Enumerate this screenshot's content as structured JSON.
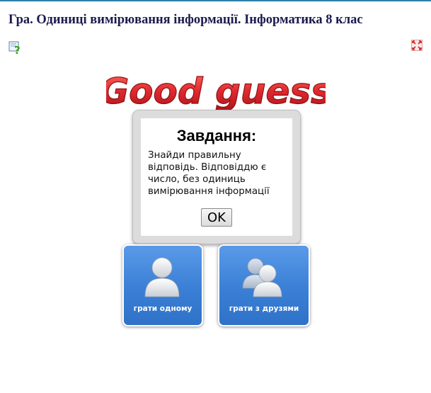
{
  "page": {
    "title": "Гра. Одиниці вимірювання інформації. Інформатика 8 клас",
    "help_icon": "help-question-icon",
    "fullscreen_icon": "fullscreen-toggle-icon"
  },
  "game": {
    "logo_text": "Good guess",
    "dialog": {
      "title": "Завдання:",
      "text": "Знайди правильну відповідь. Відповіддю є число, без одиниць вимірювання інформації",
      "ok_label": "OK"
    },
    "modes": [
      {
        "label": "грати одному",
        "icon": "single-user-icon"
      },
      {
        "label": "грати з друзями",
        "icon": "multi-user-icon"
      }
    ]
  },
  "colors": {
    "accent_line": "#2b7fa8",
    "title_text": "#1a1a4e",
    "logo_red": "#e0282e",
    "tile_blue": "#3a7fd6"
  }
}
